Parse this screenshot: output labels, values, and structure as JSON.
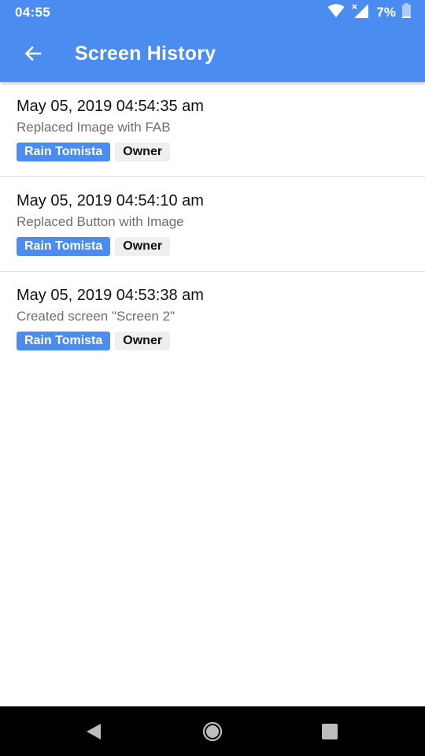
{
  "status_bar": {
    "time": "04:55",
    "battery": "7%"
  },
  "app_bar": {
    "title": "Screen History"
  },
  "history": [
    {
      "timestamp": "May 05, 2019 04:54:35 am",
      "description": "Replaced Image with FAB",
      "user": "Rain Tomista",
      "role": "Owner"
    },
    {
      "timestamp": "May 05, 2019 04:54:10 am",
      "description": "Replaced Button with Image",
      "user": "Rain Tomista",
      "role": "Owner"
    },
    {
      "timestamp": "May 05, 2019 04:53:38 am",
      "description": "Created screen \"Screen 2\"",
      "user": "Rain Tomista",
      "role": "Owner"
    }
  ],
  "colors": {
    "primary": "#4a8cf0",
    "role_chip": "#efefef"
  },
  "icons": {
    "back": "arrow-left-icon",
    "wifi": "wifi-icon",
    "signal": "signal-icon",
    "battery": "battery-icon",
    "nav_back": "triangle-back-icon",
    "nav_home": "circle-home-icon",
    "nav_recents": "square-recents-icon"
  }
}
